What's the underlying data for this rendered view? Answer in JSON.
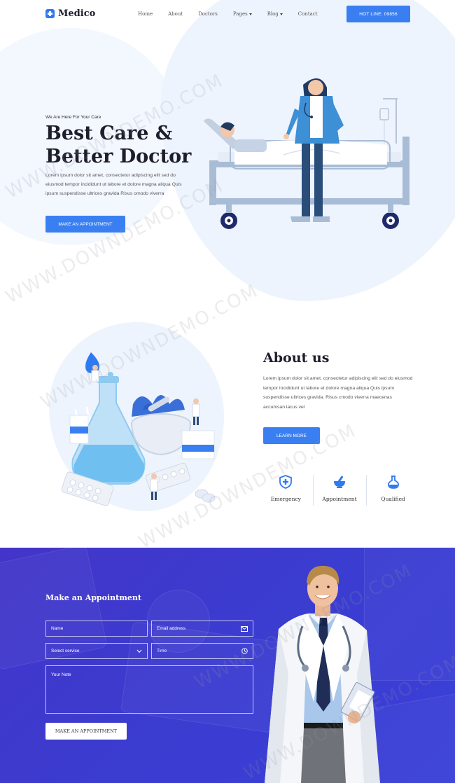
{
  "brand": {
    "name": "Medico"
  },
  "nav": {
    "items": [
      "Home",
      "About",
      "Doctors",
      "Pages",
      "Blog",
      "Contact"
    ],
    "hotline": "HOT LINE: 09856"
  },
  "hero": {
    "tagline": "We Are Here For Your Care",
    "title_line1": "Best Care &",
    "title_line2": "Better Doctor",
    "description": "Lorem ipsum dolor sit amet, consectetur adipiscing elit sed do eiusmod tempor incididunt ut labore et dolore magna aliqua Quis ipsum suspendisse ultrices gravida Risus omodo viverra",
    "button": "MAKE AN APPOINTMENT"
  },
  "about": {
    "title": "About us",
    "description": "Lorem ipsum dolor sit amet, consectetur adipiscing elit sed do eiusmod tempor incididunt ut labore et dolore magna aliqua Quis ipsum suspendisse ultrices gravida. Risus cmodo viverra maecenas accumsan lacus vel",
    "button": "LEARN MORE",
    "features": [
      "Emergency",
      "Appointment",
      "Qualified"
    ]
  },
  "appointment": {
    "title": "Make an Appointment",
    "fields": {
      "name": "Name",
      "email": "Email address",
      "service": "Select service",
      "time": "Time",
      "note": "Your Note"
    },
    "button": "MAKE AN APPOINTMENT"
  },
  "watermark": "WWW.DOWNDEMO.COM",
  "colors": {
    "accent": "#3a7ff2",
    "section_bg": "#3b3cd0",
    "blob": "#eef4fd"
  }
}
